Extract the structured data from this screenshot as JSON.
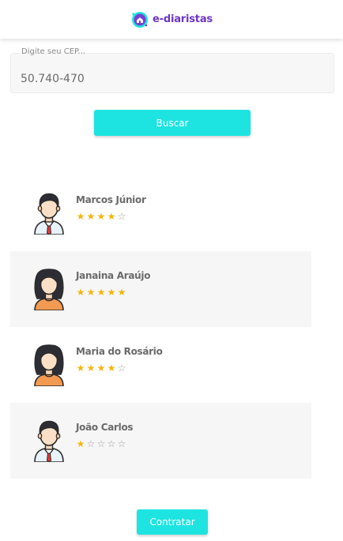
{
  "brand": {
    "name": "e-diaristas",
    "logo_icon": "house-logo-icon",
    "color": "#6d35c4"
  },
  "search": {
    "label": "Digite seu CEP...",
    "value": "50.740-470",
    "button_label": "Buscar"
  },
  "accent_color": "#1de4e0",
  "star_color": "#f5b50a",
  "diaristas": [
    {
      "name": "Marcos Júnior",
      "rating": 4,
      "max_rating": 5,
      "avatar": "male-avatar-icon"
    },
    {
      "name": "Janaina Araújo",
      "rating": 5,
      "max_rating": 5,
      "avatar": "female-avatar-icon"
    },
    {
      "name": "Maria do Rosário",
      "rating": 4,
      "max_rating": 5,
      "avatar": "female-avatar-icon"
    },
    {
      "name": "João Carlos",
      "rating": 1,
      "max_rating": 5,
      "avatar": "male-avatar-icon"
    }
  ],
  "contract": {
    "button_label": "Contratar"
  }
}
